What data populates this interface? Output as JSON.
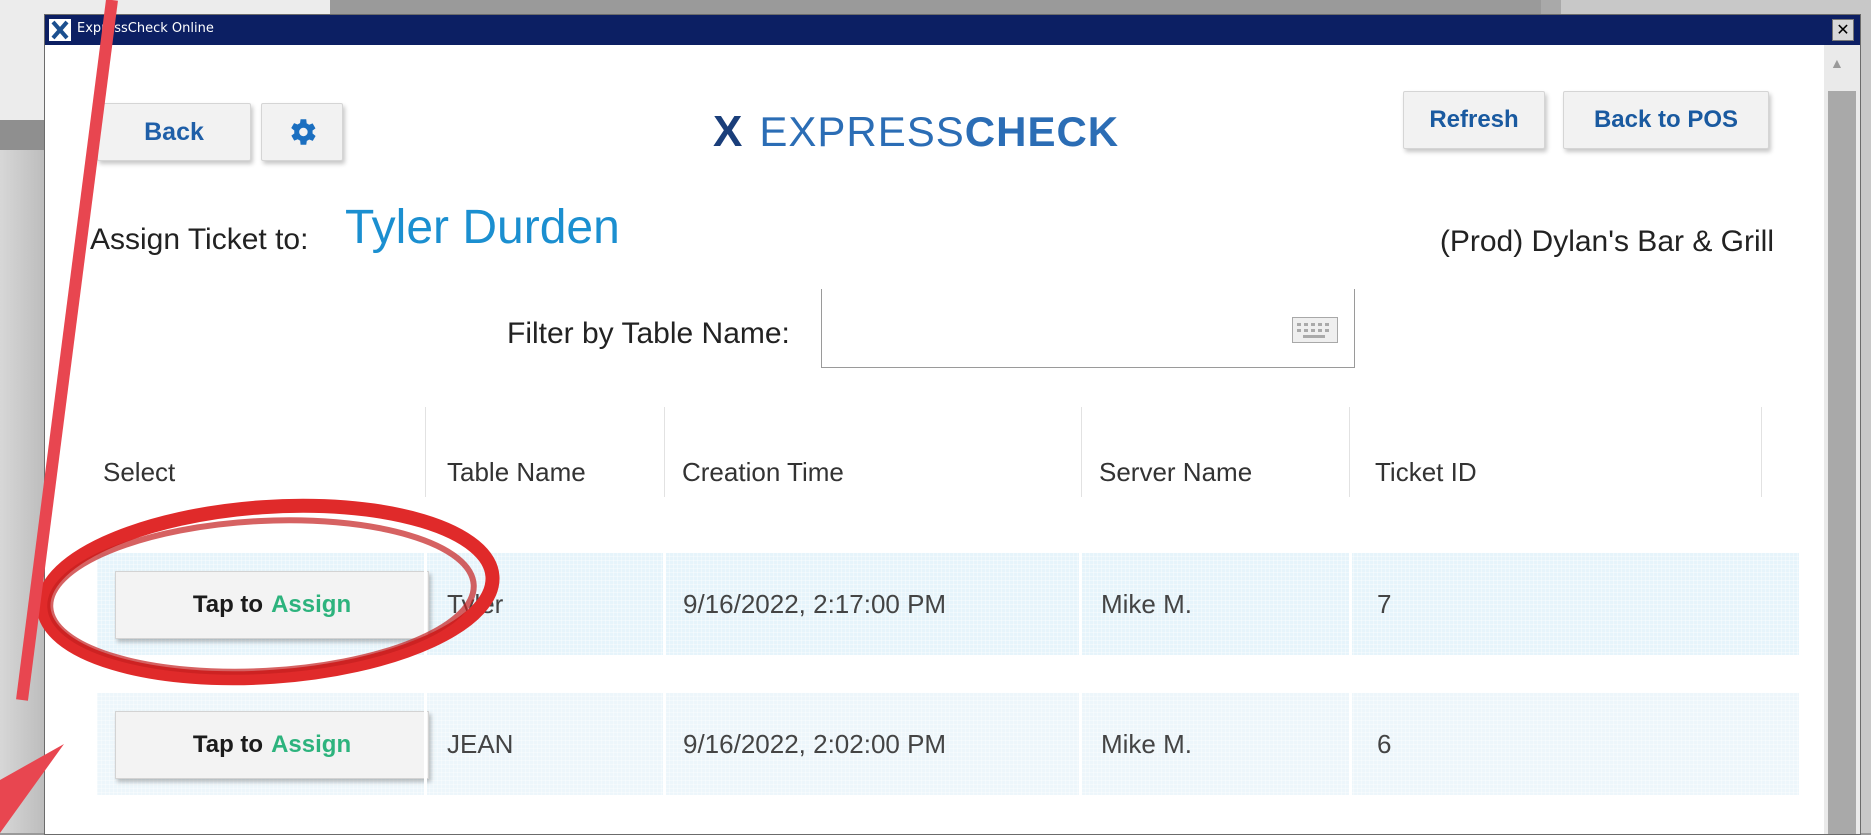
{
  "window": {
    "title": "ExpressCheck Online",
    "close_glyph": "✕",
    "icon": "expresscheck-x-icon"
  },
  "toolbar": {
    "back_label": "Back",
    "settings_icon": "gear-icon",
    "refresh_label": "Refresh",
    "back_to_pos_label": "Back to POS"
  },
  "logo": {
    "mark": "X",
    "part1": "EXPRESS",
    "part2": "CHECK"
  },
  "assign": {
    "label": "Assign Ticket to:",
    "server": "Tyler Durden"
  },
  "venue": "(Prod) Dylan's Bar & Grill",
  "filter": {
    "label": "Filter by Table Name:",
    "value": "",
    "icon": "keyboard-icon"
  },
  "table": {
    "headers": [
      "Select",
      "Table Name",
      "Creation Time",
      "Server Name",
      "Ticket ID"
    ],
    "rows": [
      {
        "button_tap": "Tap to",
        "button_assign": "Assign",
        "table_name": "Tyler",
        "creation_time": "9/16/2022, 2:17:00 PM",
        "server_name": "Mike M.",
        "ticket_id": "7"
      },
      {
        "button_tap": "Tap to",
        "button_assign": "Assign",
        "table_name": "JEAN",
        "creation_time": "9/16/2022, 2:02:00 PM",
        "server_name": "Mike M.",
        "ticket_id": "6"
      }
    ]
  },
  "colors": {
    "titlebar": "#0c1f63",
    "accent_blue": "#1b8fd0",
    "assign_green": "#2db37d",
    "row_highlight": "#e6f4fb",
    "annotation_red": "#e02a2a"
  }
}
